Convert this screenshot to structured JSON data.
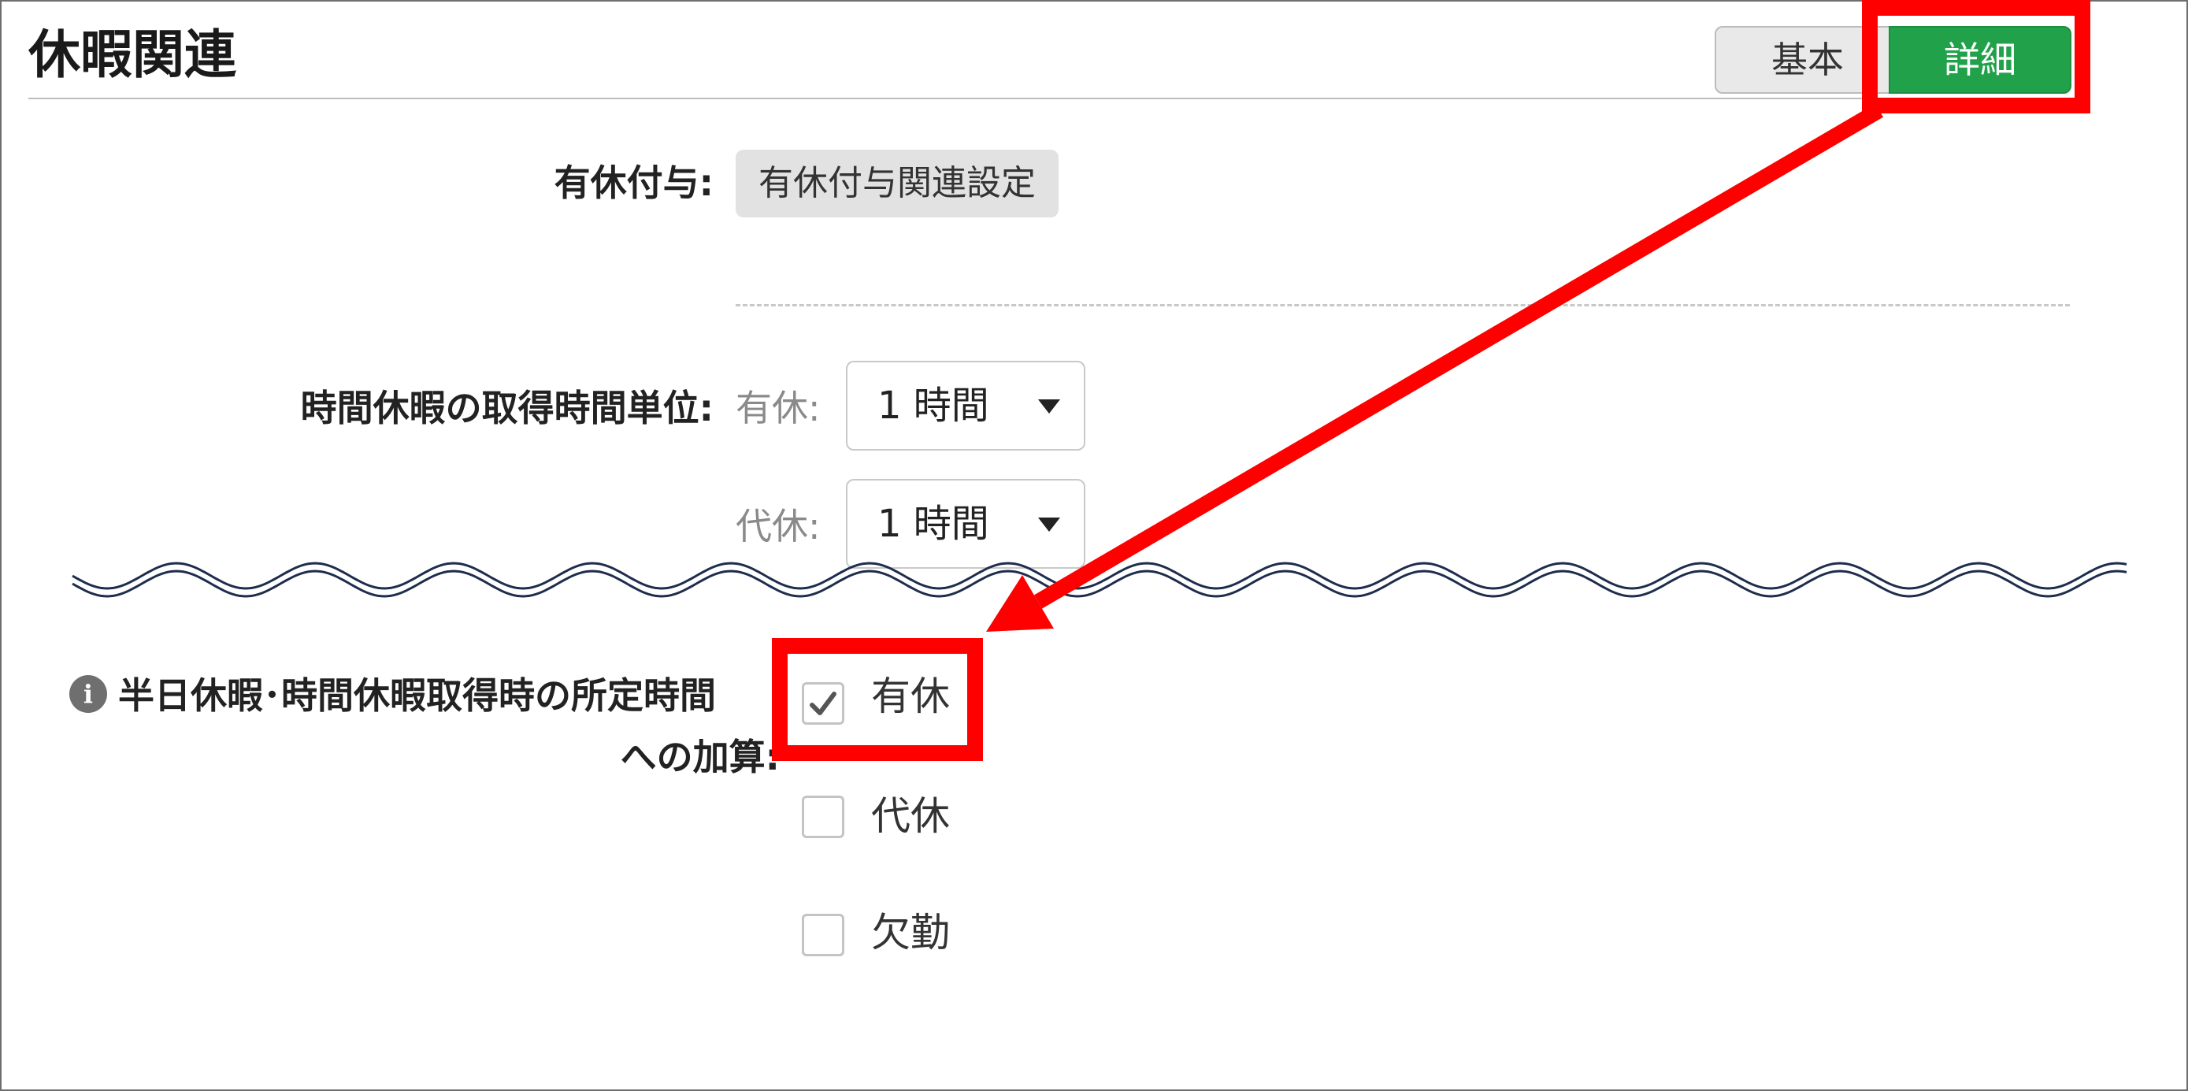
{
  "section": {
    "title": "休暇関連"
  },
  "view_toggle": {
    "basic_label": "基本",
    "detail_label": "詳細",
    "selected": "詳細",
    "active_color": "#21a24a"
  },
  "paid_leave_grant": {
    "label": "有休付与:",
    "button_label": "有休付与関連設定"
  },
  "hourly_leave_unit": {
    "label": "時間休暇の取得時間単位:",
    "rows": [
      {
        "sublabel": "有休:",
        "value": "1 時間"
      },
      {
        "sublabel": "代休:",
        "value": "1 時間"
      }
    ]
  },
  "prescribed_time_addition": {
    "label_line1": "半日休暇･時間休暇取得時の所定時間",
    "label_line2": "への加算:",
    "icon": "info-icon",
    "options": [
      {
        "label": "有休",
        "checked": true
      },
      {
        "label": "代休",
        "checked": false
      },
      {
        "label": "欠勤",
        "checked": false
      }
    ]
  },
  "annotation_color": "#ff0000"
}
